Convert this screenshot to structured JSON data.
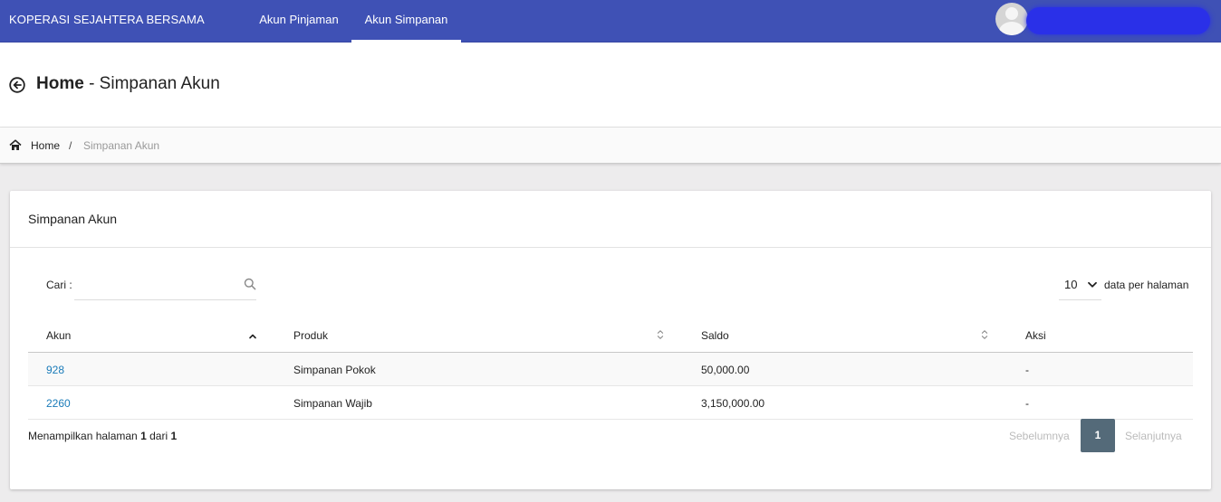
{
  "navbar": {
    "brand": "KOPERASI SEJAHTERA BERSAMA",
    "tabs": [
      {
        "label": "Akun Pinjaman",
        "active": false
      },
      {
        "label": "Akun Simpanan",
        "active": true
      }
    ],
    "user_name": "",
    "accent": "#3f51b5"
  },
  "header": {
    "title_bold": "Home",
    "title_rest": " - Simpanan Akun"
  },
  "breadcrumb": {
    "home": "Home",
    "separator": "/",
    "current": "Simpanan Akun"
  },
  "card": {
    "title": "Simpanan Akun",
    "search": {
      "label": "Cari :",
      "value": "",
      "placeholder": ""
    },
    "per_page": {
      "selected": "10",
      "label": "data per halaman"
    },
    "table": {
      "headers": [
        "Akun",
        "Produk",
        "Saldo",
        "Aksi"
      ],
      "rows": [
        {
          "akun": "928",
          "produk": "Simpanan Pokok",
          "saldo": "50,000.00",
          "aksi": "-"
        },
        {
          "akun": "2260",
          "produk": "Simpanan Wajib",
          "saldo": "3,150,000.00",
          "aksi": "-"
        }
      ]
    },
    "pagination": {
      "info_prefix": "Menampilkan halaman ",
      "current": "1",
      "info_mid": " dari ",
      "total": "1",
      "prev_label": "Sebelumnya",
      "page_label": "1",
      "next_label": "Selanjutnya"
    }
  }
}
